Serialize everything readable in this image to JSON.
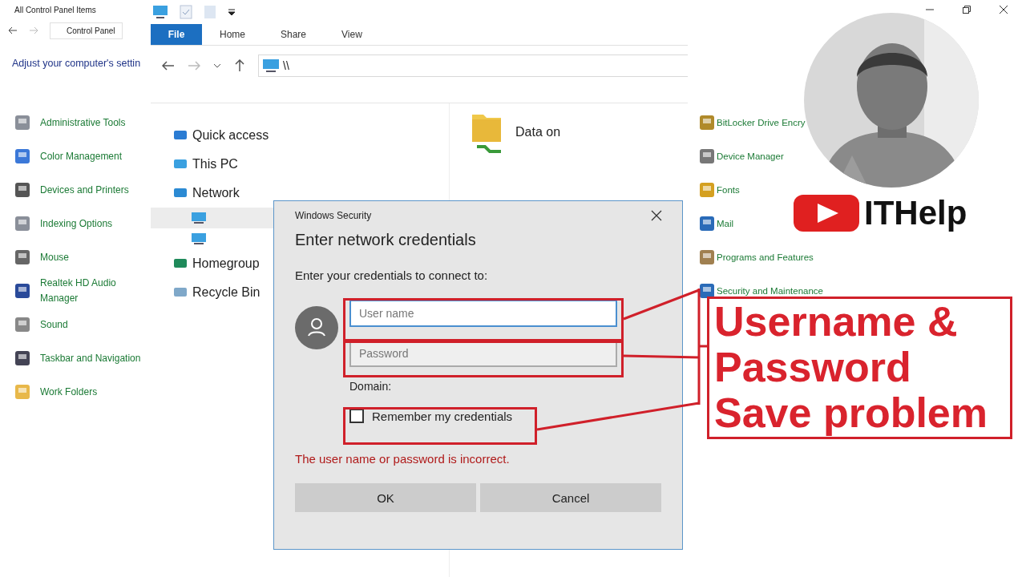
{
  "control_panel": {
    "title": "All Control Panel Items",
    "breadcrumb": "Control Panel",
    "heading": "Adjust your computer's settin",
    "left_items": [
      {
        "label": "Administrative Tools"
      },
      {
        "label": "Color Management"
      },
      {
        "label": "Devices and Printers"
      },
      {
        "label": "Indexing Options"
      },
      {
        "label": "Mouse"
      },
      {
        "label": "Realtek HD Audio Manager"
      },
      {
        "label": "Sound"
      },
      {
        "label": "Taskbar and Navigation"
      },
      {
        "label": "Work Folders"
      }
    ],
    "right_items": [
      {
        "label": "BitLocker Drive Encry"
      },
      {
        "label": "Device Manager"
      },
      {
        "label": "Fonts"
      },
      {
        "label": "Mail"
      },
      {
        "label": "Programs and Features"
      },
      {
        "label": "Security and Maintenance"
      }
    ]
  },
  "explorer": {
    "address": "\\\\",
    "tabs": [
      {
        "label": "File",
        "selected": true
      },
      {
        "label": "Home",
        "selected": false
      },
      {
        "label": "Share",
        "selected": false
      },
      {
        "label": "View",
        "selected": false
      }
    ],
    "nav": [
      {
        "label": "Quick access"
      },
      {
        "label": "This PC"
      },
      {
        "label": "Network",
        "children": [
          {
            "selected": true
          },
          {
            "selected": false
          }
        ]
      },
      {
        "label": "Homegroup"
      },
      {
        "label": "Recycle Bin"
      }
    ],
    "content_item": "Data on"
  },
  "dialog": {
    "title": "Windows Security",
    "heading": "Enter network credentials",
    "prompt": "Enter your credentials to connect to:",
    "username": {
      "placeholder": "User name"
    },
    "password": {
      "placeholder": "Password"
    },
    "domain_label": "Domain:",
    "remember": {
      "label": "Remember my credentials",
      "checked": false
    },
    "error": "The user name or password is incorrect.",
    "buttons": [
      "OK",
      "Cancel"
    ]
  },
  "overlay": {
    "channel": "ITHelp",
    "callout_lines": [
      "Username &",
      "Password",
      "Save problem"
    ]
  }
}
